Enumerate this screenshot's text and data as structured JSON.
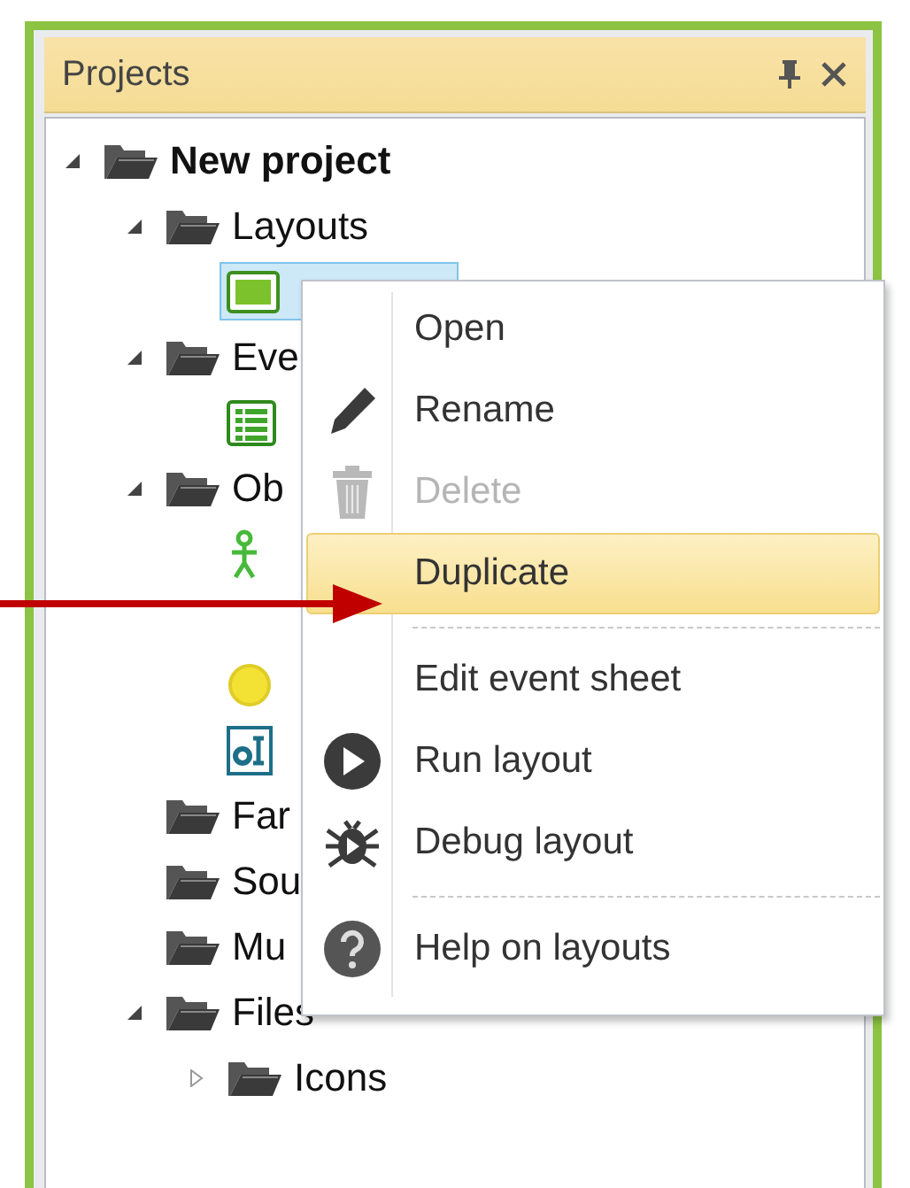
{
  "panel": {
    "title": "Projects"
  },
  "tree": [
    {
      "label": "New project",
      "kind": "folder",
      "expanded": true,
      "selected": false,
      "children": [
        {
          "label": "Layouts",
          "kind": "folder",
          "expanded": true,
          "selected": false,
          "children": [
            {
              "kind": "layout",
              "selected": true
            }
          ]
        },
        {
          "label": "Eve",
          "kind": "folder",
          "expanded": true,
          "selected": false,
          "children": [
            {
              "kind": "event-sheet",
              "selected": false
            }
          ]
        },
        {
          "label": "Ob",
          "kind": "folder",
          "expanded": true,
          "selected": false,
          "children": [
            {
              "kind": "sprite",
              "selected": false
            },
            {
              "kind": "blank"
            },
            {
              "kind": "circle",
              "selected": false
            },
            {
              "kind": "text-object",
              "selected": false
            }
          ]
        },
        {
          "label": "Far",
          "kind": "folder",
          "selected": false
        },
        {
          "label": "Sou",
          "kind": "folder",
          "selected": false
        },
        {
          "label": "Mu",
          "kind": "folder",
          "selected": false
        },
        {
          "label": "Files",
          "kind": "folder",
          "expanded": true,
          "selected": false,
          "children": [
            {
              "label": "Icons",
              "kind": "folder",
              "expanded": false,
              "selected": false
            }
          ]
        }
      ]
    }
  ],
  "context_menu": [
    {
      "kind": "plain",
      "label": "Open",
      "disabled": false,
      "selected": false
    },
    {
      "kind": "pencil",
      "label": "Rename",
      "disabled": false,
      "selected": false
    },
    {
      "kind": "trash",
      "label": "Delete",
      "disabled": true,
      "selected": false
    },
    {
      "kind": "plain",
      "label": "Duplicate",
      "disabled": false,
      "selected": true
    },
    {
      "kind": "separator"
    },
    {
      "kind": "plain",
      "label": "Edit event sheet",
      "disabled": false,
      "selected": false
    },
    {
      "kind": "play",
      "label": "Run layout",
      "disabled": false,
      "selected": false
    },
    {
      "kind": "bug",
      "label": "Debug layout",
      "disabled": false,
      "selected": false
    },
    {
      "kind": "separator"
    },
    {
      "kind": "help",
      "label": "Help on layouts",
      "disabled": false,
      "selected": false
    }
  ],
  "pointer": {
    "kind": "arrow"
  }
}
